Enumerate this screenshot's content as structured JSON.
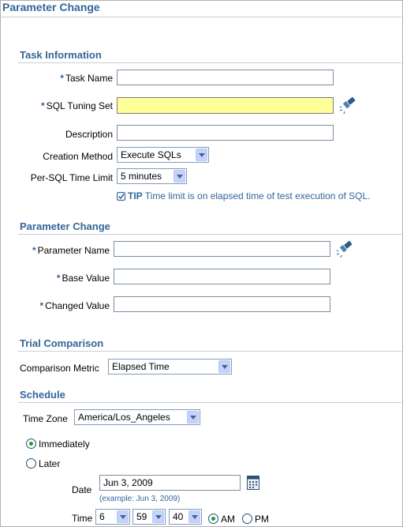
{
  "page": {
    "title": "Parameter Change"
  },
  "task_info": {
    "heading": "Task Information",
    "task_name_label": "Task Name",
    "task_name_value": "",
    "sql_tuning_set_label": "SQL Tuning Set",
    "sql_tuning_set_value": "",
    "description_label": "Description",
    "description_value": "",
    "creation_method_label": "Creation Method",
    "creation_method_value": "Execute SQLs",
    "time_limit_label": "Per-SQL Time Limit",
    "time_limit_value": "5 minutes",
    "tip_prefix": "TIP",
    "tip_text": "Time limit is on elapsed time of test execution of SQL."
  },
  "param_change": {
    "heading": "Parameter Change",
    "param_name_label": "Parameter Name",
    "param_name_value": "",
    "base_value_label": "Base Value",
    "base_value_value": "",
    "changed_value_label": "Changed Value",
    "changed_value_value": ""
  },
  "trial": {
    "heading": "Trial Comparison",
    "metric_label": "Comparison Metric",
    "metric_value": "Elapsed Time"
  },
  "schedule": {
    "heading": "Schedule",
    "timezone_label": "Time Zone",
    "timezone_value": "America/Los_Angeles",
    "immediately_label": "Immediately",
    "later_label": "Later",
    "date_label": "Date",
    "date_value": "Jun 3, 2009",
    "date_example": "(example: Jun 3, 2009)",
    "time_label": "Time",
    "hour_value": "6",
    "minute_value": "59",
    "second_value": "40",
    "am_label": "AM",
    "pm_label": "PM"
  },
  "colors": {
    "accent": "#336699",
    "required_field": "#ffff99"
  }
}
